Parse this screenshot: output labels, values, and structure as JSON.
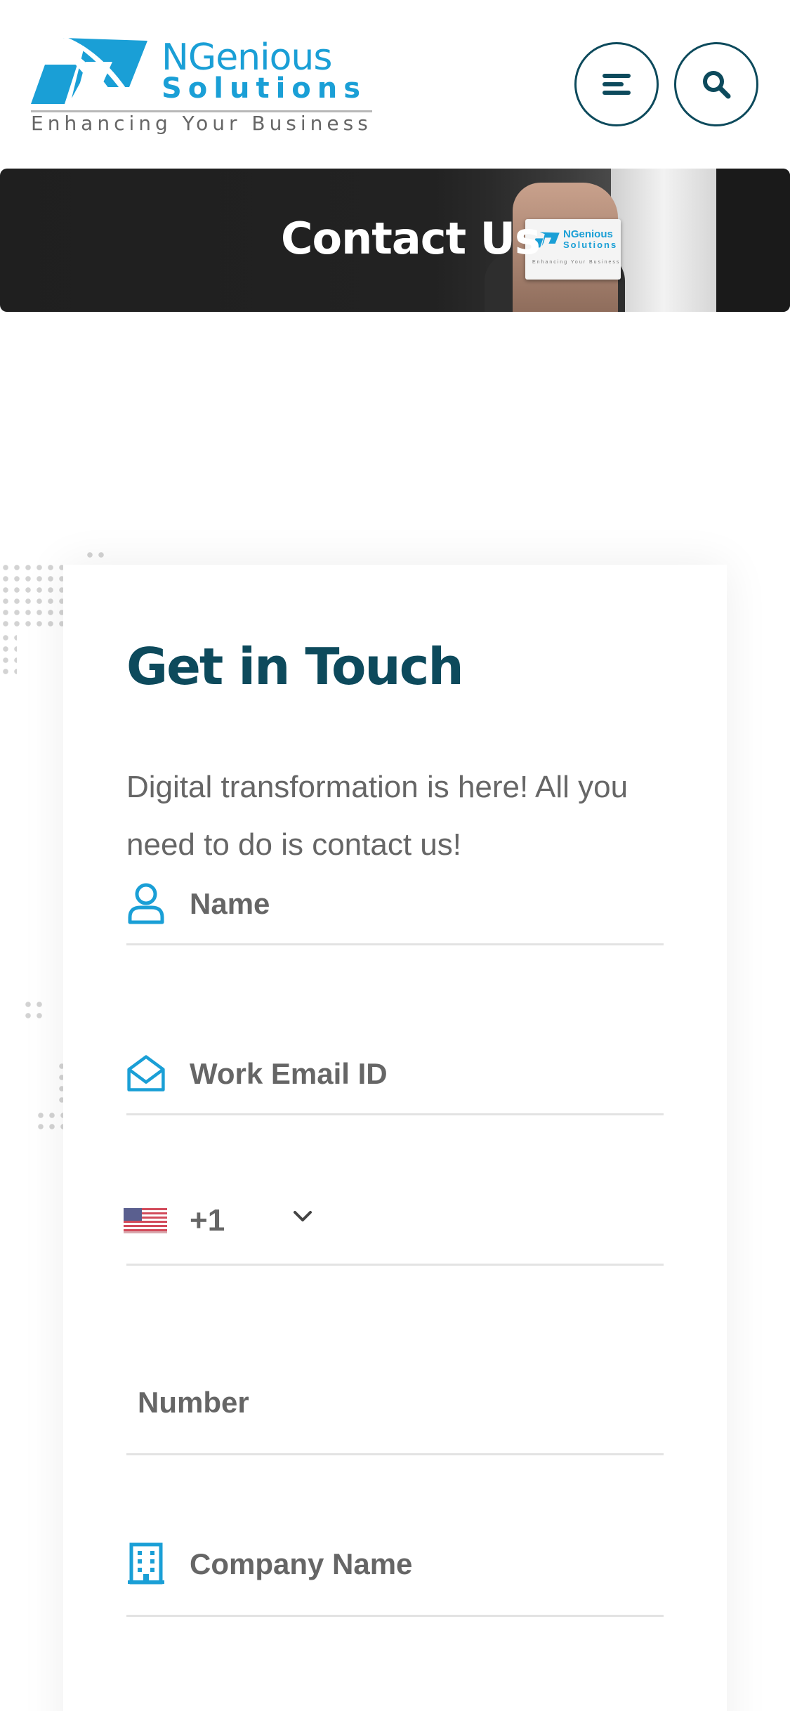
{
  "header": {
    "logo_name": "NGenious",
    "logo_sub": "Solutions",
    "logo_tagline": "Enhancing Your Business",
    "menu_icon": "menu-icon",
    "search_icon": "search-icon"
  },
  "banner": {
    "title": "Contact Us",
    "card_name": "NGenious",
    "card_sub": "Solutions",
    "card_tagline": "Enhancing Your Business"
  },
  "form": {
    "title": "Get in Touch",
    "description": "Digital transformation is here! All you need to do is contact us!",
    "fields": {
      "name": {
        "label": "Name",
        "icon": "user-icon"
      },
      "email": {
        "label": "Work Email ID",
        "icon": "envelope-icon"
      },
      "phone": {
        "country_flag": "us-flag-icon",
        "dial_code": "+1",
        "icon": "chevron-down-icon"
      },
      "number": {
        "label": "Number"
      },
      "company": {
        "label": "Company Name",
        "icon": "building-icon"
      }
    }
  },
  "colors": {
    "brand_blue": "#1a9fd6",
    "heading_teal": "#0d4a5c",
    "text_gray": "#666666",
    "divider": "#e3e3e3",
    "banner_bg": "#1f1f1f"
  }
}
